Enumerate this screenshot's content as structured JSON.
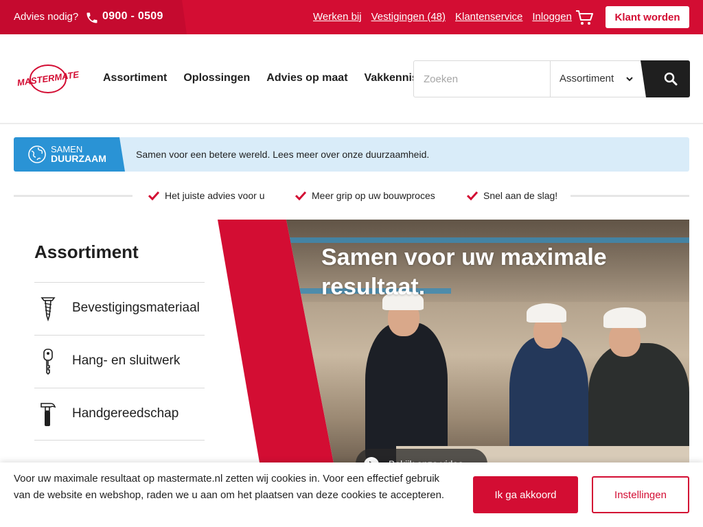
{
  "topbar": {
    "advice_label": "Advies nodig?",
    "phone_icon": "phone-icon",
    "phone_number": "0900 - 0509",
    "links": [
      "Werken bij",
      "Vestigingen (48)",
      "Klantenservice",
      "Inloggen"
    ],
    "cart_icon": "shopping-cart-icon",
    "cta_label": "Klant worden"
  },
  "header": {
    "logo_text": "MASTERMATE",
    "nav": [
      "Assortiment",
      "Oplossingen",
      "Advies op maat",
      "Vakkennis"
    ],
    "search": {
      "placeholder": "Zoeken",
      "value": "",
      "scope_selected": "Assortiment",
      "submit_icon": "search-icon"
    }
  },
  "sustainability_banner": {
    "badge_line1": "SAMEN",
    "badge_line2": "DUURZAAM",
    "message": "Samen voor een betere wereld. Lees meer over onze duurzaamheid."
  },
  "usps": [
    "Het juiste advies voor u",
    "Meer grip op uw bouwproces",
    "Snel aan de slag!"
  ],
  "assortment_panel": {
    "title": "Assortiment",
    "categories": [
      {
        "label": "Bevestigingsmateriaal",
        "icon": "screw-icon"
      },
      {
        "label": "Hang- en sluitwerk",
        "icon": "key-icon"
      },
      {
        "label": "Handgereedschap",
        "icon": "hammer-icon"
      }
    ]
  },
  "hero": {
    "title": "Samen voor uw maximale resultaat.",
    "video_label": "Bekijk onze video"
  },
  "cookie_bar": {
    "text": "Voor uw maximale resultaat op mastermate.nl zetten wij cookies in. Voor een effectief gebruik van de website en webshop, raden we u aan om het plaatsen van deze cookies te accepteren.",
    "accept_label": "Ik ga akkoord",
    "settings_label": "Instellingen"
  },
  "colors": {
    "brand_red": "#d30d33",
    "dark": "#1f1f1f",
    "sustainability_blue": "#2a93d5",
    "banner_bg": "#d9ecf9"
  }
}
